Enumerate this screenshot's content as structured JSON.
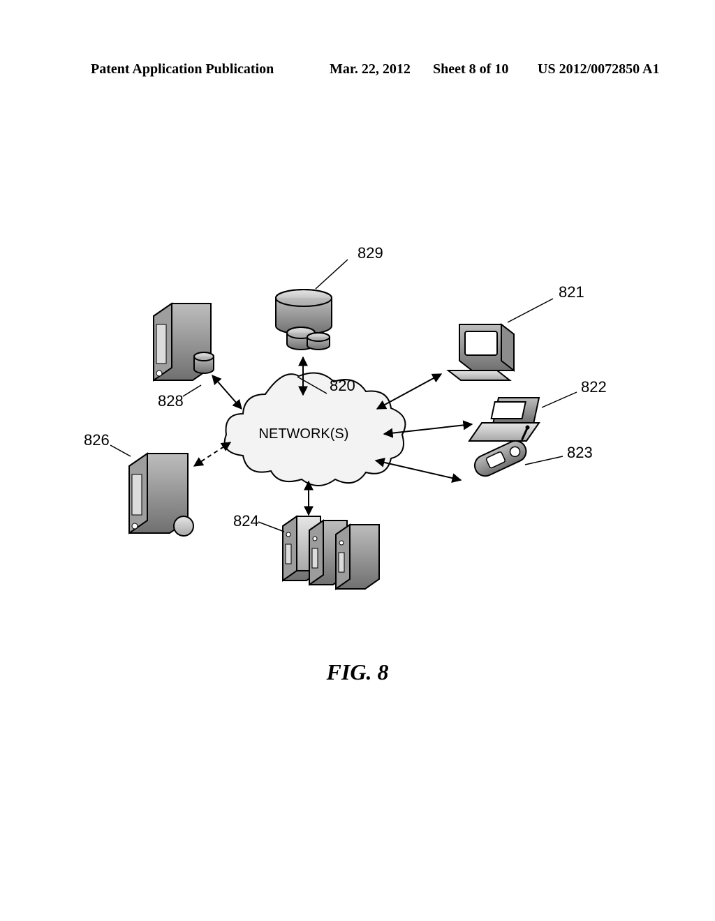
{
  "header": {
    "pub_type": "Patent Application Publication",
    "date": "Mar. 22, 2012",
    "sheet": "Sheet 8 of 10",
    "pub_number": "US 2012/0072850 A1"
  },
  "figure": {
    "caption": "FIG. 8",
    "network_label": "NETWORK(S)",
    "callouts": {
      "database": "829",
      "desktop": "821",
      "laptop": "822",
      "phone": "823",
      "servers": "824",
      "server_bottom_left": "826",
      "server_top_left": "828",
      "cloud": "820"
    },
    "nodes": [
      {
        "id": "820",
        "kind": "network-cloud"
      },
      {
        "id": "821",
        "kind": "desktop-computer"
      },
      {
        "id": "822",
        "kind": "laptop"
      },
      {
        "id": "823",
        "kind": "mobile-phone"
      },
      {
        "id": "824",
        "kind": "server-rack"
      },
      {
        "id": "826",
        "kind": "server-tower"
      },
      {
        "id": "828",
        "kind": "server-tower"
      },
      {
        "id": "829",
        "kind": "database"
      }
    ]
  }
}
